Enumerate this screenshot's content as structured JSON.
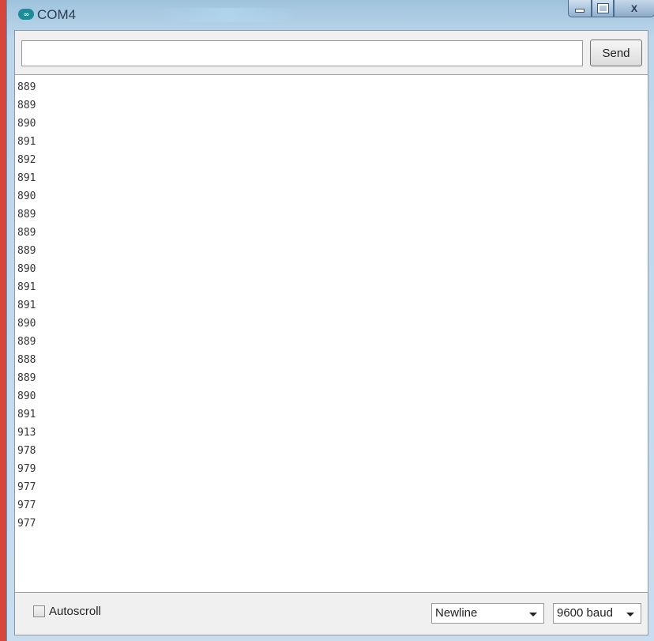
{
  "window": {
    "title": "COM4",
    "app_icon": "arduino-infinity-icon",
    "controls": {
      "minimize": "minimize-icon",
      "maximize": "maximize-icon",
      "close_label": "X"
    }
  },
  "input": {
    "value": "",
    "placeholder": ""
  },
  "send_label": "Send",
  "output_lines": [
    "889",
    "889",
    "890",
    "891",
    "892",
    "891",
    "890",
    "889",
    "889",
    "889",
    "890",
    "891",
    "891",
    "890",
    "889",
    "888",
    "889",
    "890",
    "891",
    "913",
    "978",
    "979",
    "977",
    "977",
    "977"
  ],
  "autoscroll": {
    "label": "Autoscroll",
    "checked": false
  },
  "line_ending": {
    "selected": "Newline"
  },
  "baud_rate": {
    "selected": "9600 baud"
  },
  "colors": {
    "accent": "#1e8c96",
    "frame": "#c9ddef",
    "background": "#d6463a"
  }
}
